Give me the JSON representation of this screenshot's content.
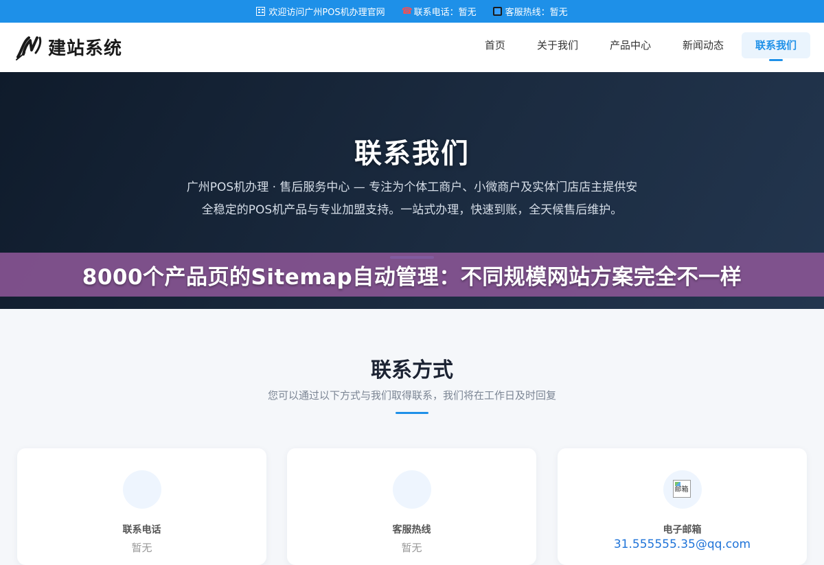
{
  "topbar": {
    "welcome": "欢迎访问广州POS机办理官网",
    "phone": "联系电话：暂无",
    "hotline": "客服热线：暂无",
    "icons": [
      "building-icon",
      "phone-icon",
      "mobile-icon"
    ]
  },
  "header": {
    "logo_text": "建站系统",
    "nav": [
      "首页",
      "关于我们",
      "产品中心",
      "新闻动态",
      "联系我们"
    ],
    "active_nav": "联系我们"
  },
  "hero": {
    "title": "联系我们",
    "description": "广州POS机办理 · 售后服务中心 — 专注为个体工商户、小微商户及实体门店店主提供安全稳定的POS机产品与专业加盟支持。一站式办理，快速到账，全天候售后维护。"
  },
  "overlay": {
    "text": "8000个产品页的Sitemap自动管理：不同规模网站方案完全不一样"
  },
  "contact": {
    "title": "联系方式",
    "subtitle": "您可以通过以下方式与我们取得联系，我们将在工作日及时回复",
    "cards": [
      {
        "label": "联系电话",
        "value": "暂无"
      },
      {
        "label": "客服热线",
        "value": "暂无"
      },
      {
        "label": "电子邮箱",
        "value": "31.555555.35@qq.com",
        "icon_alt": "邮箱"
      }
    ]
  },
  "colors": {
    "accent": "#1e90e8",
    "hero_bg": "#152236",
    "overlay": "#8c5696"
  }
}
